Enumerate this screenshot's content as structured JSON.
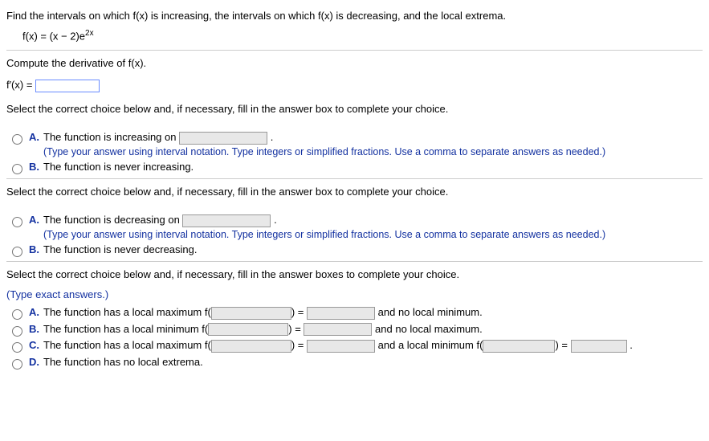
{
  "prompt": "Find the intervals on which f(x) is increasing, the intervals on which f(x) is decreasing, and the local extrema.",
  "formula_lhs": "f(x) = (x − 2)e",
  "formula_sup": "2x",
  "compute": "Compute the derivative of f(x).",
  "fprime": "f′(x) =",
  "select1": "Select the correct choice below and, if necessary, fill in the answer box to complete your choice.",
  "inc": {
    "A_text_pre": "The function is increasing on ",
    "A_hint": "(Type your answer using interval notation. Type integers or simplified fractions. Use a comma to separate answers as needed.)",
    "B_text": "The function is never increasing."
  },
  "select2": "Select the correct choice below and, if necessary, fill in the answer box to complete your choice.",
  "dec": {
    "A_text_pre": "The function is decreasing on ",
    "A_hint": "(Type your answer using interval notation. Type integers or simplified fractions. Use a comma to separate answers as needed.)",
    "B_text": "The function is never decreasing."
  },
  "select3": "Select the correct choice below and, if necessary, fill in the answer boxes to complete your choice.",
  "exact_hint": "(Type exact answers.)",
  "ext": {
    "A_pre": "The function has a local maximum f",
    "A_mid": " and no local minimum.",
    "B_pre": "The function has a local minimum f",
    "B_mid": " and no local maximum.",
    "C_pre": "The function has a local maximum f",
    "C_mid": " and a local minimum f",
    "D_text": "The function has no local extrema."
  },
  "labels": {
    "A": "A.",
    "B": "B.",
    "C": "C.",
    "D": "D."
  },
  "eq": " = ",
  "period": ".",
  "paren_open": "(",
  "paren_close": ")"
}
